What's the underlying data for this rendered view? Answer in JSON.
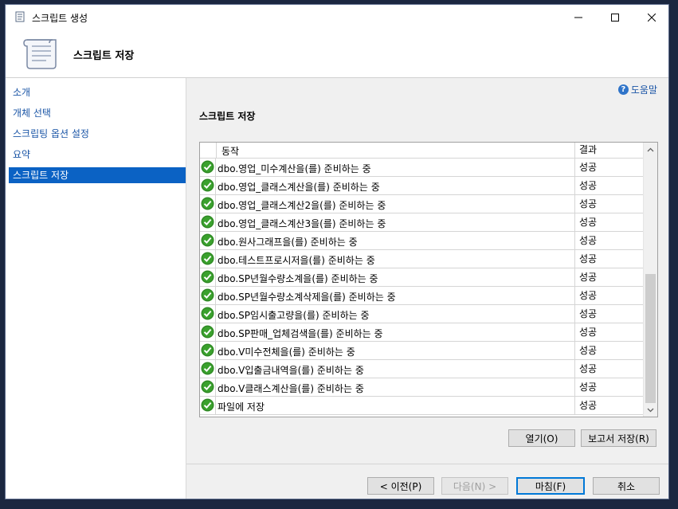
{
  "window": {
    "title": "스크립트 생성",
    "header_title": "스크립트 저장"
  },
  "sidebar": {
    "items": [
      {
        "label": "소개"
      },
      {
        "label": "개체 선택"
      },
      {
        "label": "스크립팅 옵션 설정"
      },
      {
        "label": "요약"
      },
      {
        "label": "스크립트 저장",
        "active": true
      }
    ]
  },
  "main": {
    "help_label": "도움말",
    "section_title": "스크립트 저장",
    "table": {
      "columns": [
        "동작",
        "결과"
      ],
      "rows": [
        {
          "action": "dbo.영업_미수계산을(를) 준비하는 중",
          "result": "성공"
        },
        {
          "action": "dbo.영업_클래스계산을(를) 준비하는 중",
          "result": "성공"
        },
        {
          "action": "dbo.영업_클래스계산2을(를) 준비하는 중",
          "result": "성공"
        },
        {
          "action": "dbo.영업_클래스계산3을(를) 준비하는 중",
          "result": "성공"
        },
        {
          "action": "dbo.원사그래프을(를) 준비하는 중",
          "result": "성공"
        },
        {
          "action": "dbo.테스트프로시저을(를) 준비하는 중",
          "result": "성공"
        },
        {
          "action": "dbo.SP년월수량소계을(를) 준비하는 중",
          "result": "성공"
        },
        {
          "action": "dbo.SP년월수량소계삭제을(를) 준비하는 중",
          "result": "성공"
        },
        {
          "action": "dbo.SP임시출고량을(를) 준비하는 중",
          "result": "성공"
        },
        {
          "action": "dbo.SP판매_업체검색을(를) 준비하는 중",
          "result": "성공"
        },
        {
          "action": "dbo.V미수전체을(를) 준비하는 중",
          "result": "성공"
        },
        {
          "action": "dbo.V입출금내역을(를) 준비하는 중",
          "result": "성공"
        },
        {
          "action": "dbo.V클래스계산을(를) 준비하는 중",
          "result": "성공"
        },
        {
          "action": "파일에 저장",
          "result": "성공"
        }
      ]
    },
    "buttons": {
      "open": "열기(O)",
      "save_report": "보고서 저장(R)"
    }
  },
  "footer": {
    "prev": "< 이전(P)",
    "next": "다음(N) >",
    "finish": "마침(F)",
    "cancel": "취소"
  },
  "icons": {
    "success": "check-circle-icon",
    "help": "help-icon"
  },
  "colors": {
    "accent": "#0b62c4",
    "link": "#1a55a6",
    "success": "#3aa12d"
  }
}
